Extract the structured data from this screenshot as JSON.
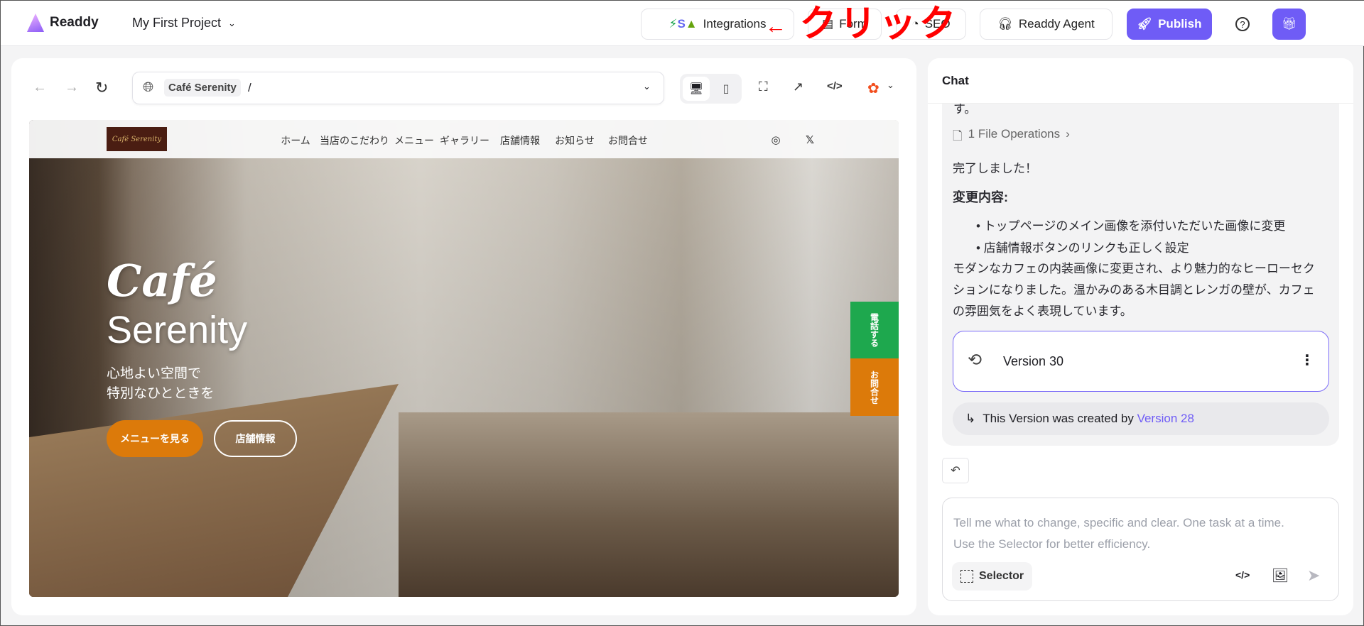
{
  "topbar": {
    "brand": "Readdy",
    "project": "My First Project",
    "integrations": "Integrations",
    "form": "Form",
    "seo": "SEO",
    "agent": "Readdy Agent",
    "publish": "Publish",
    "annotation": "クリック",
    "annotation_arrow": "←"
  },
  "browser": {
    "site_name": "Café Serenity",
    "path": "/"
  },
  "site": {
    "logo": "Café Serenity",
    "nav": [
      "ホーム",
      "当店のこだわり",
      "メニュー",
      "ギャラリー",
      "店舗情報",
      "お知らせ",
      "お問合せ"
    ],
    "hero_title_1": "Café",
    "hero_title_2": "Serenity",
    "hero_sub_1": "心地よい空間で",
    "hero_sub_2": "特別なひとときを",
    "btn_menu": "メニューを見る",
    "btn_store": "店舗情報",
    "side_call": "電話する",
    "side_contact": "お問合せ",
    "colors": {
      "orange": "#dc7a0a",
      "green": "#1ea84e"
    }
  },
  "chat": {
    "title": "Chat",
    "partial": "す。",
    "file_ops": "1 File Operations",
    "done": "完了しました！",
    "changes_heading": "変更内容:",
    "bullets": [
      "トップページのメイン画像を添付いただいた画像に変更",
      "店舗情報ボタンのリンクも正しく設定"
    ],
    "para": [
      "モダンなカフェの内装画像に変更され、より魅力的なヒーローセク",
      "ションになりました。温かみのある木目調とレンガの壁が、カフェ",
      "の雰囲気をよく表現しています。"
    ],
    "version": "Version 30",
    "created_by": "This Version was created by ",
    "created_by_link": "Version 28",
    "placeholder": "Tell me what to change, specific and clear. One task at a time. Use the Selector for better efficiency.",
    "placeholder_1": "Tell me what to change, specific and clear. One task at a time.",
    "placeholder_2": "Use the Selector for better efficiency.",
    "selector": "Selector"
  },
  "accent": "#6f5cf6"
}
